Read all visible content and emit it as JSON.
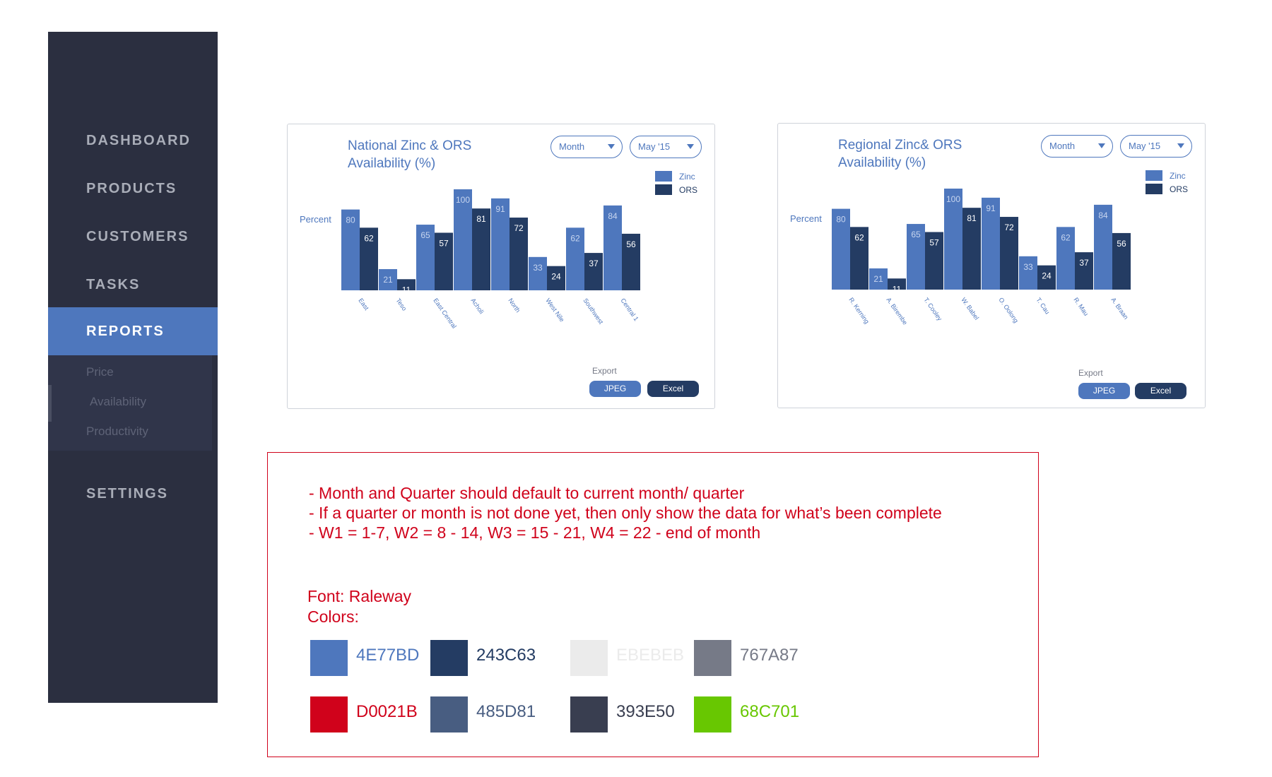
{
  "sidebar": {
    "items": [
      {
        "label": "DASHBOARD"
      },
      {
        "label": "PRODUCTS"
      },
      {
        "label": "CUSTOMERS"
      },
      {
        "label": "TASKS"
      },
      {
        "label": "REPORTS"
      },
      {
        "label": "SETTINGS"
      }
    ],
    "subitems": [
      {
        "label": "Price"
      },
      {
        "label": "Availability"
      },
      {
        "label": "Productivity"
      }
    ]
  },
  "colors": {
    "zinc": "#4e77bd",
    "ors": "#243c63",
    "sidebar": "#2b2f40",
    "note": "#d0021b"
  },
  "cards": [
    {
      "title_line1": "National Zinc & ORS",
      "title_line2": "Availability (%)",
      "period_select": "Month",
      "date_select": "May '15",
      "ylabel": "Percent",
      "legend": [
        "Zinc",
        "ORS"
      ],
      "export_label": "Export",
      "jpeg_label": "JPEG",
      "excel_label": "Excel"
    },
    {
      "title_line1": "Regional Zinc& ORS",
      "title_line2": "Availability (%)",
      "period_select": "Month",
      "date_select": "May '15",
      "ylabel": "Percent",
      "legend": [
        "Zinc",
        "ORS"
      ],
      "export_label": "Export",
      "jpeg_label": "JPEG",
      "excel_label": "Excel"
    }
  ],
  "chart_data": [
    {
      "type": "bar",
      "title": "National Zinc & ORS Availability (%)",
      "ylabel": "Percent",
      "categories": [
        "East",
        "Teso",
        "East Central",
        "Acholi",
        "North",
        "West Nile",
        "Southwest",
        "Central 1"
      ],
      "series": [
        {
          "name": "Zinc",
          "values": [
            80,
            21,
            65,
            100,
            91,
            33,
            62,
            84
          ]
        },
        {
          "name": "ORS",
          "values": [
            62,
            11,
            57,
            81,
            72,
            24,
            37,
            56
          ]
        }
      ],
      "ylim": [
        0,
        100
      ],
      "grid": false,
      "legend": "top-right"
    },
    {
      "type": "bar",
      "title": "Regional Zinc& ORS Availability (%)",
      "ylabel": "Percent",
      "categories": [
        "R. Kerning",
        "A. Birembe",
        "T. Cooley",
        "W. Babel",
        "O. Oolong",
        "T. Cau",
        "R. Mau",
        "A. Braan"
      ],
      "series": [
        {
          "name": "Zinc",
          "values": [
            80,
            21,
            65,
            100,
            91,
            33,
            62,
            84
          ]
        },
        {
          "name": "ORS",
          "values": [
            62,
            11,
            57,
            81,
            72,
            24,
            37,
            56
          ]
        }
      ],
      "ylim": [
        0,
        100
      ],
      "grid": false,
      "legend": "top-right"
    }
  ],
  "notes": {
    "lines": [
      "- Month and Quarter should default to current month/ quarter",
      "- If a quarter or month is not done yet, then only show the data for what’s been complete",
      "- W1 = 1-7, W2 = 8 - 14, W3 = 15 - 21, W4 = 22 - end of month"
    ],
    "font": "Font: Raleway",
    "colors_label": "Colors:",
    "swatches": [
      {
        "hex": "4E77BD",
        "color": "#4e77bd",
        "text_color": "#4e77bd"
      },
      {
        "hex": "243C63",
        "color": "#243c63",
        "text_color": "#243c63"
      },
      {
        "hex": "EBEBEB",
        "color": "#ebebeb",
        "text_color": "#ebebeb"
      },
      {
        "hex": "767A87",
        "color": "#767a87",
        "text_color": "#767a87"
      },
      {
        "hex": "D0021B",
        "color": "#d0021b",
        "text_color": "#d0021b"
      },
      {
        "hex": "485D81",
        "color": "#485d81",
        "text_color": "#485d81"
      },
      {
        "hex": "393E50",
        "color": "#393e50",
        "text_color": "#393e50"
      },
      {
        "hex": "68C701",
        "color": "#68c701",
        "text_color": "#68c701"
      }
    ]
  }
}
